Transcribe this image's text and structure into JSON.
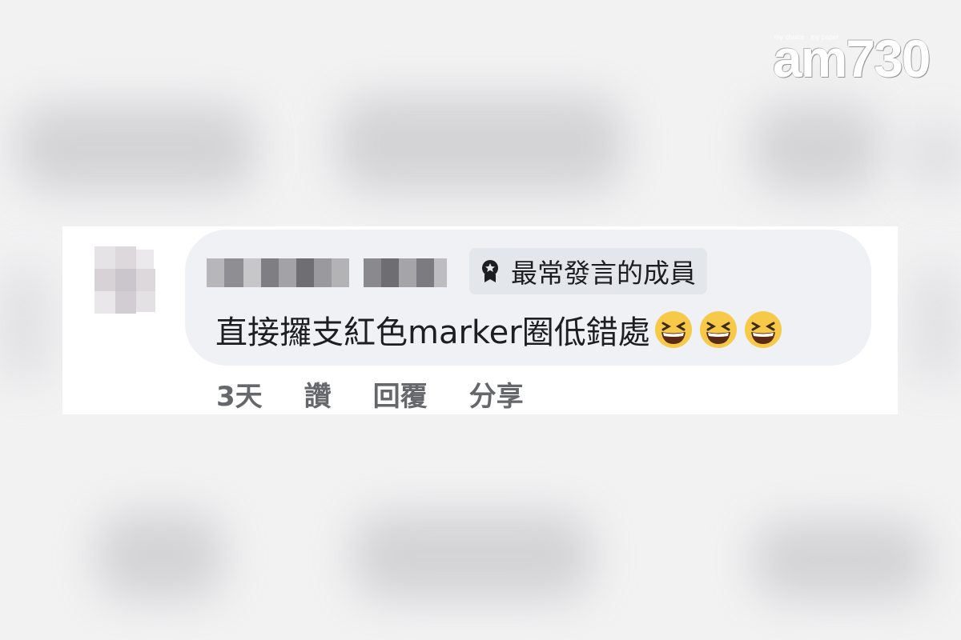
{
  "watermark": {
    "tagline": "my choice · my paper",
    "brand": "am730"
  },
  "comment": {
    "badge_icon": "badge-icon",
    "badge_label": "最常發言的成員",
    "text": "直接攞支紅色marker圈低錯處",
    "emojis": [
      "grinning-squinting-face",
      "grinning-squinting-face",
      "grinning-squinting-face"
    ]
  },
  "actions": {
    "time": "3天",
    "like": "讚",
    "reply": "回覆",
    "share": "分享"
  }
}
